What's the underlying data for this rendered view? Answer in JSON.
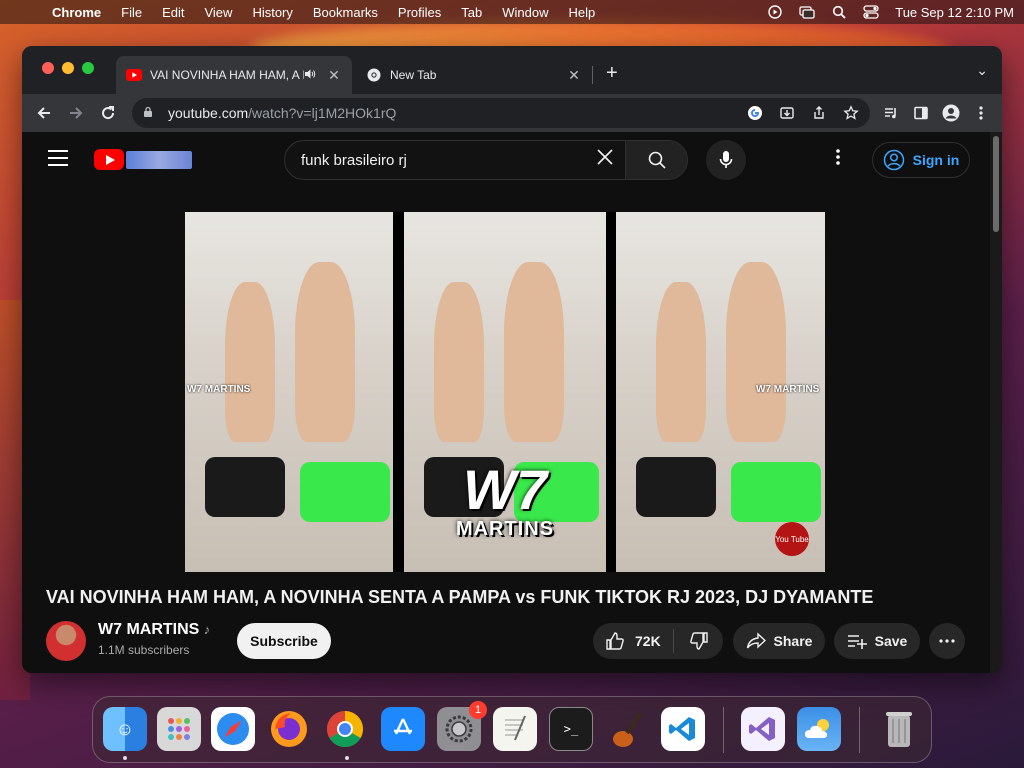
{
  "menubar": {
    "app_name": "Chrome",
    "items": [
      "File",
      "Edit",
      "View",
      "History",
      "Bookmarks",
      "Profiles",
      "Tab",
      "Window",
      "Help"
    ],
    "clock": "Tue Sep 12  2:10 PM"
  },
  "tabs": [
    {
      "title": "VAI NOVINHA HAM HAM, A NOVINHA SENTA A PAMPA",
      "favicon": "youtube-icon",
      "playing_audio": true
    },
    {
      "title": "New Tab",
      "favicon": "chrome-icon"
    }
  ],
  "omnibox": {
    "host": "youtube.com",
    "path": "/watch?v=lj1M2HOk1rQ"
  },
  "youtube": {
    "search_query": "funk brasileiro rj",
    "sign_in": "Sign in",
    "video": {
      "title": "VAI NOVINHA HAM HAM, A NOVINHA SENTA A PAMPA vs FUNK TIKTOK RJ 2023, DJ DYAMANTE",
      "watermark_text": "W7 MARTINS",
      "logo_big": "W7",
      "logo_small": "MARTINS",
      "badge": "You Tube"
    },
    "channel": {
      "name": "W7 MARTINS",
      "music_note": "♪",
      "subscribers": "1.1M subscribers",
      "subscribe_label": "Subscribe"
    },
    "actions": {
      "likes": "72K",
      "share_label": "Share",
      "save_label": "Save"
    }
  },
  "dock": {
    "apps": [
      {
        "name": "finder",
        "color": "#2a8cf0"
      },
      {
        "name": "launchpad",
        "color": "#cfcfcf"
      },
      {
        "name": "safari",
        "color": "#3a9af0"
      },
      {
        "name": "firefox",
        "color": "#ff7a1a"
      },
      {
        "name": "chrome",
        "color": "#ffffff"
      },
      {
        "name": "app-store",
        "color": "#1e88ff"
      },
      {
        "name": "system-settings",
        "color": "#8e8e93",
        "badge": "1"
      },
      {
        "name": "textedit",
        "color": "#f5f5f0"
      },
      {
        "name": "terminal",
        "color": "#1c1c1c"
      },
      {
        "name": "garageband",
        "color": "#3a2a1a"
      },
      {
        "name": "vscode",
        "color": "#ffffff"
      },
      {
        "name": "visual-studio",
        "color": "#f5f0ff"
      },
      {
        "name": "weather",
        "color": "#3b8fe6"
      },
      {
        "name": "trash",
        "color": "#9a9a9a"
      }
    ]
  }
}
